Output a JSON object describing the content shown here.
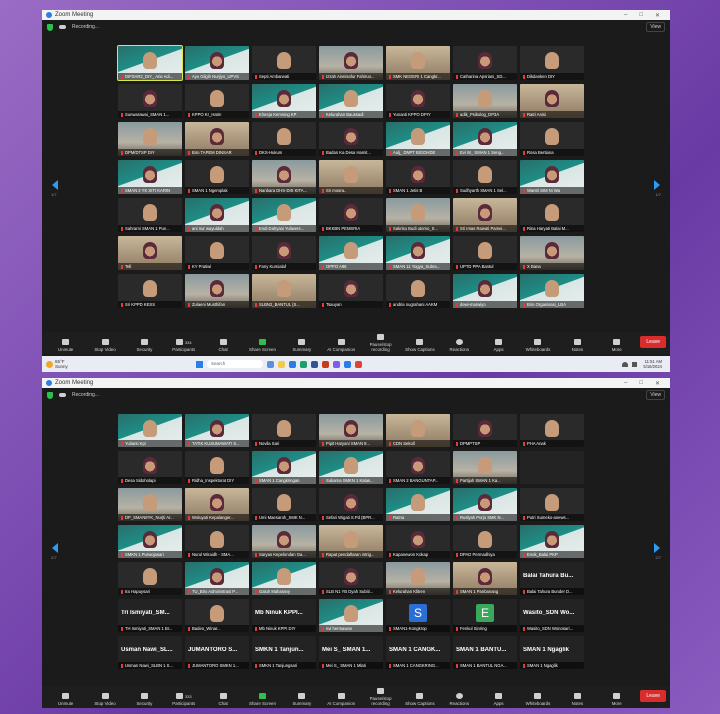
{
  "window_title": "Zoom Meeting",
  "recording": "Recording...",
  "view_label": "View",
  "shot1": {
    "page_left": "1/7",
    "page_right": "1/7",
    "tiles": [
      "DIFSAR2_DIY_ Arie Adi...",
      "Ayu Gilgih Nurjiyo_UPVS",
      "Septi Ambarwati",
      "Izzah Ainnisafur Fahiruo...",
      "SMK NEGERI 1 Cangkr...",
      "Catharina Apsriani_SD...",
      "Dikdanken DIY",
      "Sunwarawai_SMAN 1...",
      "KPPO Kr_Hatm",
      "Elnreja Kemning KP",
      "Kelurahan Baussadi",
      "Yunanti KPPO DPIY",
      "adik_Psikolog_DP3A",
      "Ratri Anisi",
      "DPM/DTSP DIY",
      "Biro TAPEM DINSAR",
      "DKS-Hukum",
      "Badan Ka Desa Hamit...",
      "Aulj_ DNPT BIGOHDE",
      "Evi W_ SMAN 1 Seng...",
      "Rosa Bertiana",
      "SMAN 2 YK SITI KARIN",
      "SMAN 1 Ngemplak",
      "Nanbara DHS-DIS KITA...",
      "Sri mosra..",
      "SMAN 1 Jetis B",
      "Sudhyarth SMAN 1 Sel...",
      "Wantri SIM Ni Wa",
      "Sahrarni SMAN 1 Pun...",
      "ani nur wayuldah",
      "Endi Dahyani Yuliwers...",
      "BKKBN PEMSRIA",
      "Sakrisu Budi utomo_S...",
      "Sri Imas Rawati Pamei...",
      "Rina Haryati Balai M...",
      "Tell",
      "KY Pratiwi",
      "Fany Kurnialaf",
      "OPPO A96",
      "SMAN 11 Yogya_Subra...",
      "UPTD PPA Bantul",
      "X Bana",
      "Sri KPPD KESS",
      "Zulaeni Musthifan",
      "SLBN2_BANTUL (S...",
      "Tsauyan",
      "andria nugrahani AAKM",
      "dewi-marwiyo",
      "Biro Organisasi_LBA"
    ],
    "toolbar": [
      "Unmute",
      "Stop Video",
      "Security",
      "Participants",
      "Chat",
      "Share Screen",
      "Summary",
      "AI Companion",
      "Pause/stop recording",
      "Show Captions",
      "Reactions",
      "Apps",
      "Whiteboards",
      "Notes",
      "More"
    ],
    "participants_count": "334",
    "leave": "Leave",
    "weather_temp": "65°F",
    "weather_text": "Sunny",
    "search": "Search",
    "time": "11:51 AM",
    "date": "5/16/2024"
  },
  "shot2": {
    "page_left": "2/7",
    "page_right": "2/7",
    "tiles": [
      "Yulianti Kpi",
      "TATIK KUSUMAWATI S...",
      "Novila Sari",
      "Pipit Haryani SMAN 8...",
      "CDN Sekoll",
      "DPMPTSP",
      "PHA Anak",
      "Desa Sidoholapi",
      "Ridha_Inspektorat DIY",
      "SMAN 1 Cangkringan",
      "Sukarna SMKN 1 Kalas...",
      "SMAN 2 BANGUNTAP...",
      "Partijah SMAN 1 Ka...",
      "",
      "DP_SMAN8YK_Nurjti Ar...",
      "Woluyati Kepalanger...",
      "Umi Maesaroh_SMK N...",
      "Sefari Wigati S.Pd (BPR...",
      "Ratna",
      "Ruslyah Purjo SMK N...",
      "Putri Sumeko-anews...",
      "SMKN 1 Purwojasari",
      "Nurul Wiraidh - SMA...",
      "Saryas Kepelondan Ga...",
      "Rapat pendaftaran intrig...",
      "Kapanewon Kokap",
      "DPAD Permadhiya",
      "Enok_Balai PKP",
      "Ira Hapuysari",
      "TU_Biro Administrasi P...",
      "Galuh Maharany",
      "SLB N1 YB Dyah Subiti...",
      "Kelurahan Klitren",
      "SMAN 1 Panbanang",
      "Balai Tahura Bunder D...",
      "TH Ismiyati_SMAN 1 Br...",
      "Badeo_Winar...",
      "Mb Ninuk KPPI DIY",
      "nvi hermawan",
      "SMAN1-Kongkrop",
      "Fenkul Sinring",
      "Wasito_SDN Wonosari...",
      "Usman Nawi_SLBN 1 S...",
      "JUMANTORO SMKN 1...",
      "SMKN 1 Tanjungsari",
      "Mei S_ SMAN 1 Mlati",
      "SMAN 1 CANGKRING...",
      "SMAN 1 BANTUL NGA...",
      "SMAN 1 Ngaglik"
    ],
    "big_names": {
      "34": "Balai Tahura Bu...",
      "35": "Tri Ismiyati_SM...",
      "37": "Mb Ninuk KPPI...",
      "41": "Wasito_SDN Wo...",
      "42": "Usman Nawi_SL...",
      "43": "JUMANTORO S...",
      "44": "SMKN 1 Tanjun...",
      "45": "Mei S_ SMAN 1...",
      "46": "SMAN 1 CANGK...",
      "47": "SMAN 1 BANTU...",
      "48": "SMAN 1 Ngaglik"
    },
    "letters": {
      "39": "S",
      "40": "E"
    },
    "participants_count": "333",
    "leave": "Leave"
  },
  "colors": {
    "accent": "#2b9bf4",
    "leave": "#d92d2d",
    "active_speaker": "#d7e64b",
    "share_screen": "#2fbf4f"
  }
}
